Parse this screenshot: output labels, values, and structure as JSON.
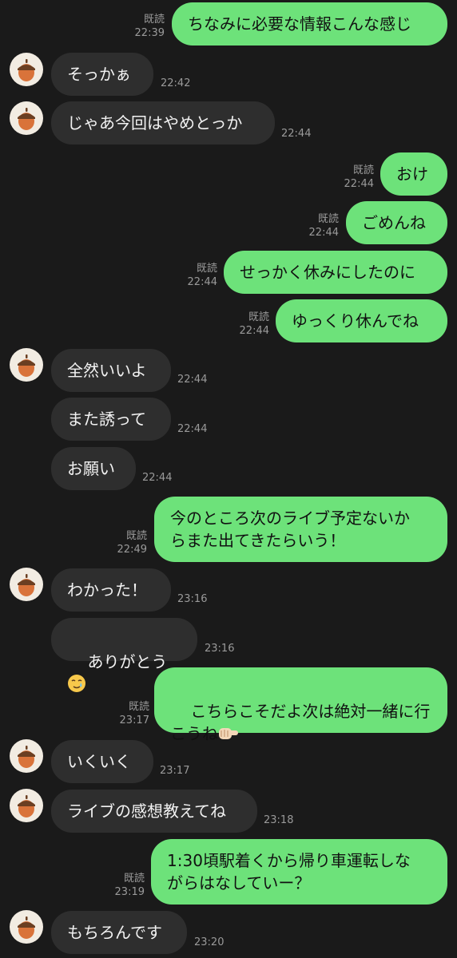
{
  "read_label": "既読",
  "messages": [
    {
      "side": "out",
      "text": "ちなみに必要な情報こんな感じ",
      "time": "22:39",
      "read": true
    },
    {
      "side": "in",
      "text": "そっかぁ",
      "time": "22:42",
      "avatar": true
    },
    {
      "side": "in",
      "text": "じゃあ今回はやめとっか",
      "time": "22:44",
      "avatar": true
    },
    {
      "side": "out",
      "text": "おけ",
      "time": "22:44",
      "read": true
    },
    {
      "side": "out",
      "text": "ごめんね",
      "time": "22:44",
      "read": true
    },
    {
      "side": "out",
      "text": "せっかく休みにしたのに",
      "time": "22:44",
      "read": true
    },
    {
      "side": "out",
      "text": "ゆっくり休んでね",
      "time": "22:44",
      "read": true
    },
    {
      "side": "in",
      "text": "全然いいよ",
      "time": "22:44",
      "avatar": true
    },
    {
      "side": "in",
      "text": "また誘って",
      "time": "22:44",
      "avatar": false
    },
    {
      "side": "in",
      "text": "お願い",
      "time": "22:44",
      "avatar": false
    },
    {
      "side": "out",
      "text": "今のところ次のライブ予定ないか\nらまた出てきたらいう！",
      "time": "22:49",
      "read": true
    },
    {
      "side": "in",
      "text": "わかった！",
      "time": "23:16",
      "avatar": true
    },
    {
      "side": "in",
      "text": "ありがとう",
      "time": "23:16",
      "avatar": false,
      "emoji": "smiling-face-with-tear"
    },
    {
      "side": "out",
      "text": "こちらこそだよ次は絶対一緒に行\nこうね",
      "time": "23:17",
      "read": true,
      "emoji": "pointing-hand"
    },
    {
      "side": "in",
      "text": "いくいく",
      "time": "23:17",
      "avatar": true
    },
    {
      "side": "in",
      "text": "ライブの感想教えてね",
      "time": "23:18",
      "avatar": true
    },
    {
      "side": "out",
      "text": "1:30頃駅着くから帰り車運転しな\nがらはなしていー？",
      "time": "23:19",
      "read": true
    },
    {
      "side": "in",
      "text": "もちろんです",
      "time": "23:20",
      "avatar": true
    }
  ],
  "colors": {
    "background": "#1a1a1a",
    "outgoing_bubble": "#6de27a",
    "incoming_bubble": "#2e2e2e",
    "meta_text": "#9a9a9a"
  }
}
